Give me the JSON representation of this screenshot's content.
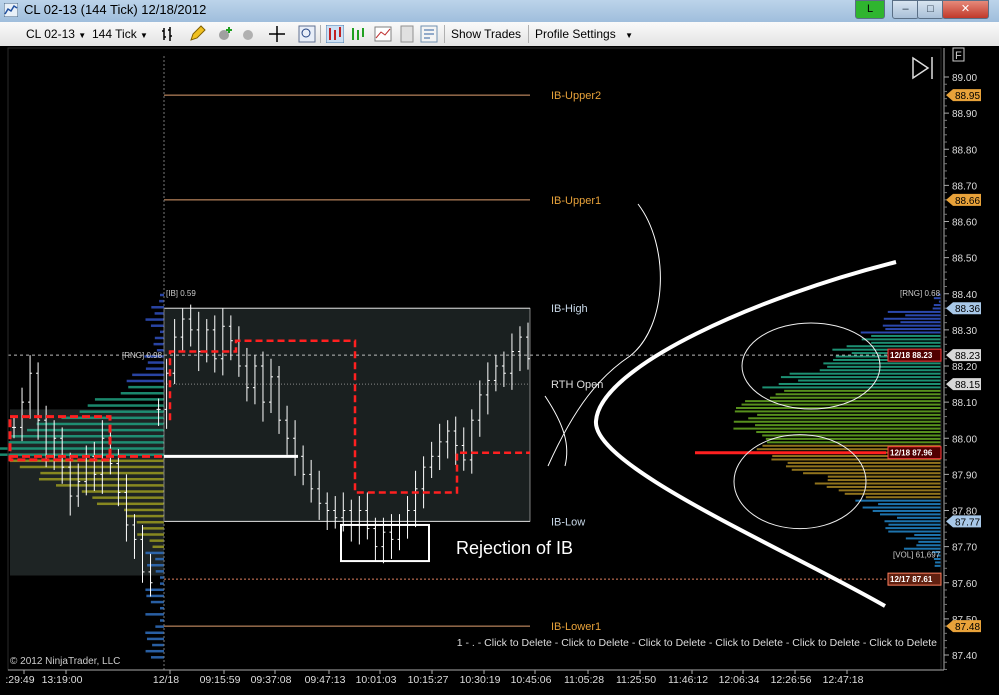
{
  "window": {
    "title": "CL 02-13 (144 Tick)  12/18/2012",
    "btn_green": "L",
    "minimize": "–",
    "maximize": "□",
    "close": "✕"
  },
  "toolbar": {
    "instrument": "CL 02-13",
    "interval": "144 Tick",
    "show_trades": "Show Trades",
    "profile_settings": "Profile Settings"
  },
  "colors": {
    "ib_upper": "#e0a070",
    "ib_inner": "#ffffff",
    "poc_red": "#ff2020",
    "price_white": "#ffffff"
  },
  "chart_data": {
    "type": "candlestick",
    "instrument": "CL 02-13",
    "yaxis": {
      "ticks": [
        "89.00",
        "88.90",
        "88.80",
        "88.70",
        "88.60",
        "88.50",
        "88.40",
        "88.30",
        "88.20",
        "88.10",
        "88.00",
        "87.90",
        "87.80",
        "87.70",
        "87.60",
        "87.50",
        "87.40"
      ],
      "range": [
        87.35,
        89.05
      ],
      "price_flags": [
        {
          "value": "88.95",
          "color": "#e8a23a"
        },
        {
          "value": "88.66",
          "color": "#e8a23a"
        },
        {
          "value": "88.36",
          "color": "#a8c8e8"
        },
        {
          "value": "88.23",
          "color": "#d8d8d8"
        },
        {
          "value": "88.15",
          "color": "#d8d8d8"
        },
        {
          "value": "87.77",
          "color": "#a8c8e8"
        },
        {
          "value": "87.48",
          "color": "#e8a23a"
        }
      ]
    },
    "xaxis": {
      "ticks": [
        ":29:49",
        "13:19:00",
        "12/18",
        "09:15:59",
        "09:37:08",
        "09:47:13",
        "10:01:03",
        "10:15:27",
        "10:30:19",
        "10:45:06",
        "11:05:28",
        "11:25:50",
        "11:46:12",
        "12:06:34",
        "12:26:56",
        "12:47:18"
      ]
    },
    "levels": [
      {
        "label": "IB-Upper2",
        "price": 88.95
      },
      {
        "label": "IB-Upper1",
        "price": 88.66
      },
      {
        "label": "IB-High",
        "price": 88.36
      },
      {
        "label": "IB-Low",
        "price": 87.77
      },
      {
        "label": "IB-Lower1",
        "price": 87.48
      }
    ],
    "rth_open_label": "RTH Open",
    "annotation": "Rejection of IB",
    "ib_label": "[IB] 0.59",
    "rng_left": "[RNG] 0.98",
    "rng_right": "[RNG] 0.68",
    "vol_right": "[VOL] 61,697",
    "flag_1218_top": "12/18 88.23",
    "flag_1218_mid": "12/18 87.96",
    "flag_1217": "12/17 87.61",
    "copyright": "© 2012 NinjaTrader, LLC",
    "delete_strip": "1 -  . - Click to Delete - Click to Delete - Click to Delete - Click to Delete - Click to Delete - Click to Delete",
    "close_prices": [
      88.03,
      88.1,
      88.18,
      88.05,
      87.95,
      88.0,
      87.92,
      87.84,
      87.88,
      87.95,
      87.9,
      88.0,
      87.93,
      87.85,
      87.76,
      87.72,
      87.63,
      87.6,
      88.08,
      88.18,
      88.28,
      88.33,
      88.3,
      88.24,
      88.3,
      88.22,
      88.31,
      88.27,
      88.2,
      88.14,
      88.2,
      88.1,
      88.17,
      88.05,
      88.0,
      87.95,
      87.9,
      87.86,
      87.82,
      87.8,
      87.78,
      87.8,
      87.76,
      87.8,
      87.75,
      87.7,
      87.74,
      87.72,
      87.76,
      87.8,
      87.86,
      87.92,
      87.95,
      87.99,
      88.02,
      87.98,
      87.94,
      88.05,
      88.12,
      88.16,
      88.2,
      88.18,
      88.24,
      88.28,
      88.22
    ],
    "right_profile_tops": [
      88.35,
      88.3,
      88.25,
      88.2,
      88.15,
      88.1,
      88.05,
      88.0,
      87.95,
      87.9,
      87.85,
      87.8,
      87.75,
      87.7
    ]
  }
}
